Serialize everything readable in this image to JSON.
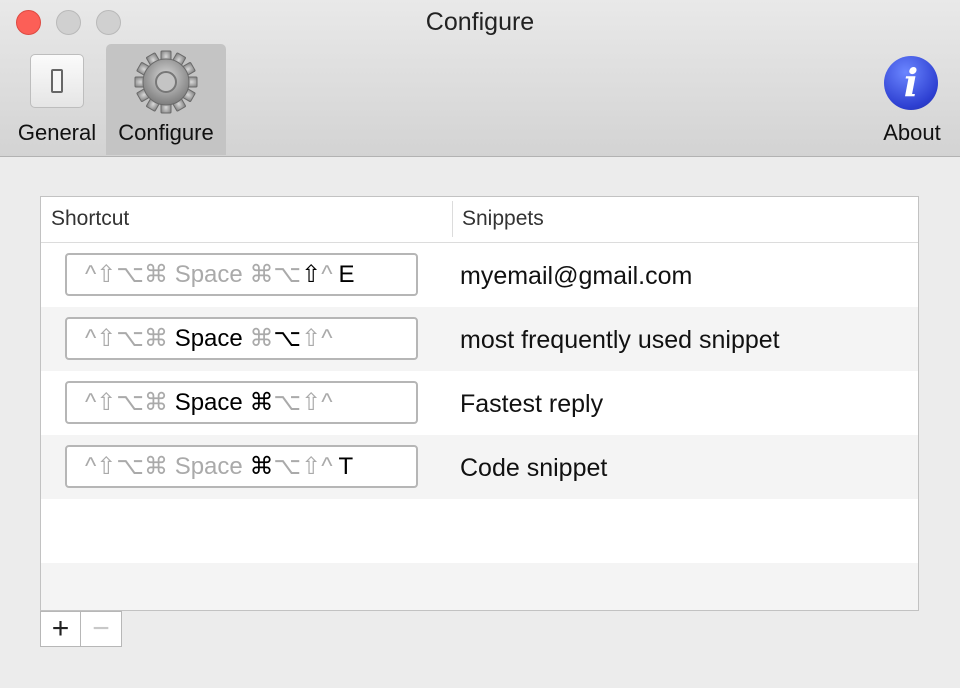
{
  "window": {
    "title": "Configure"
  },
  "toolbar": {
    "general": {
      "label": "General",
      "icon": "toggle-switch-icon"
    },
    "configure": {
      "label": "Configure",
      "icon": "gear-icon",
      "selected": true
    },
    "about": {
      "label": "About",
      "icon": "info-icon",
      "glyph": "i"
    }
  },
  "table": {
    "columns": {
      "shortcut": "Shortcut",
      "snippets": "Snippets"
    },
    "rows": [
      {
        "shortcut": {
          "mods": "^⇧⌥⌘",
          "space": "Space",
          "cmd": "⌘",
          "opt": "⌥",
          "shift": "⇧",
          "ctrl": "^",
          "key": "E"
        },
        "snippet": "myemail@gmail.com"
      },
      {
        "shortcut": {
          "mods": "^⇧⌥⌘",
          "space": "Space",
          "cmd": "⌘",
          "opt": "⌥",
          "shift": "⇧",
          "ctrl": "^",
          "key": ""
        },
        "snippet": "most frequently used snippet"
      },
      {
        "shortcut": {
          "mods": "^⇧⌥⌘",
          "space": "Space",
          "cmd": "⌘",
          "opt": "⌥",
          "shift": "⇧",
          "ctrl": "^",
          "key": ""
        },
        "snippet": "Fastest reply"
      },
      {
        "shortcut": {
          "mods": "^⇧⌥⌘",
          "space": "Space",
          "cmd": "⌘",
          "opt": "⌥",
          "shift": "⇧",
          "ctrl": "^",
          "key": "T"
        },
        "snippet": "Code snippet"
      }
    ]
  },
  "buttons": {
    "add": "+",
    "remove": "−"
  },
  "colors": {
    "close": "#fc5f57",
    "selected_tab": "#c4c4c4",
    "about_icon": "#2d3fd1"
  }
}
